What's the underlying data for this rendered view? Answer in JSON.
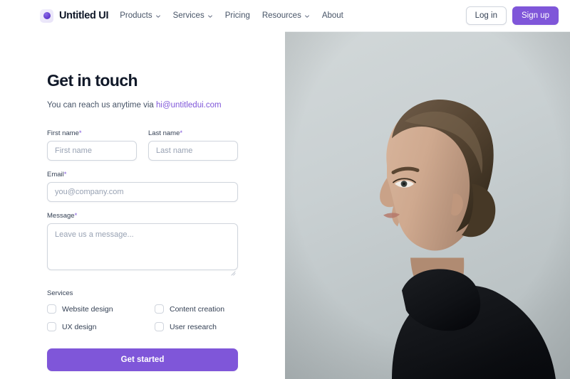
{
  "header": {
    "brand": {
      "name": "Untitled UI",
      "logo_icon": "purple-circle-logo"
    },
    "nav": [
      {
        "label": "Products",
        "has_dropdown": true,
        "icon": "chevron-down-icon"
      },
      {
        "label": "Services",
        "has_dropdown": true,
        "icon": "chevron-down-icon"
      },
      {
        "label": "Pricing",
        "has_dropdown": false,
        "icon": ""
      },
      {
        "label": "Resources",
        "has_dropdown": true,
        "icon": "chevron-down-icon"
      },
      {
        "label": "About",
        "has_dropdown": false,
        "icon": ""
      }
    ],
    "login_label": "Log in",
    "signup_label": "Sign up"
  },
  "contact": {
    "title": "Get in touch",
    "subtitle_prefix": "You can reach us anytime via ",
    "email": "hi@untitledui.com",
    "fields": {
      "first_name": {
        "label": "First name",
        "required": "*",
        "placeholder": "First name",
        "value": ""
      },
      "last_name": {
        "label": "Last name",
        "required": "*",
        "placeholder": "Last name",
        "value": ""
      },
      "email": {
        "label": "Email",
        "required": "*",
        "placeholder": "you@company.com",
        "value": ""
      },
      "message": {
        "label": "Message",
        "required": "*",
        "placeholder": "Leave us a message...",
        "value": ""
      }
    },
    "services": {
      "label": "Services",
      "options": [
        {
          "label": "Website design",
          "checked": false
        },
        {
          "label": "Content creation",
          "checked": false
        },
        {
          "label": "UX design",
          "checked": false
        },
        {
          "label": "User research",
          "checked": false
        }
      ]
    },
    "submit_label": "Get started"
  },
  "media": {
    "alt": "Portrait photo of a woman in a black turtleneck against a grey background",
    "background_color": "#c8cfd1"
  },
  "colors": {
    "brand_purple": "#7f56d9",
    "text_primary": "#101828",
    "text_secondary": "#475467",
    "border": "#d0d5dd",
    "placeholder": "#98a2b3"
  }
}
